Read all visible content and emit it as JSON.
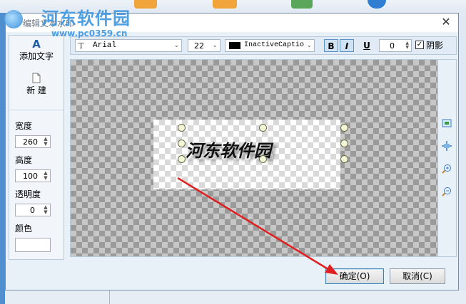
{
  "dialog": {
    "title": "编辑文本水印",
    "close_glyph": "✕"
  },
  "watermark": {
    "site_name": "河东软件园",
    "url": "www.pc0359.cn"
  },
  "tools": {
    "add_text_label": "添加文字",
    "add_text_icon": "A",
    "new_label": "新 建",
    "width_label": "宽度",
    "width_value": "260",
    "height_label": "高度",
    "height_value": "100",
    "opacity_label": "透明度",
    "opacity_value": "0",
    "color_label": "颜色"
  },
  "toolbar": {
    "font_icon": "T",
    "font_name": "Arial",
    "font_size": "22",
    "color_name": "InactiveCaptio",
    "bold_label": "B",
    "italic_label": "I",
    "underline_label": "U",
    "spacing_value": "0",
    "shadow_label": "阴影",
    "shadow_checked": true
  },
  "canvas": {
    "watermark_text": "河东软件园"
  },
  "buttons": {
    "ok_label": "确定(O)",
    "cancel_label": "取消(C)"
  },
  "colors": {
    "accent": "#3d95e0",
    "arrow": "#e02020"
  }
}
